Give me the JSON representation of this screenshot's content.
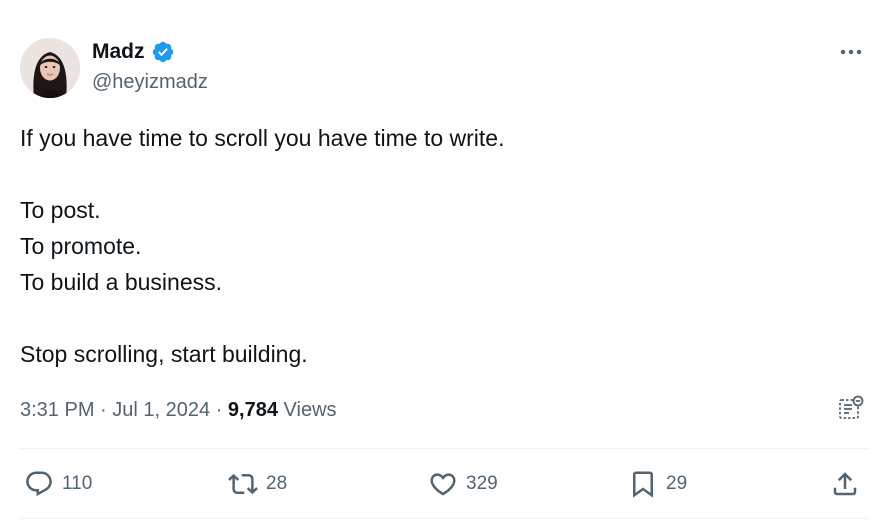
{
  "author": {
    "name": "Madz",
    "handle": "@heyizmadz",
    "verified": true
  },
  "tweet": {
    "lines": [
      "If you have time to scroll you have time to write.",
      "",
      "To post.",
      "To promote.",
      "To build a business.",
      "",
      "Stop scrolling, start building."
    ],
    "time": "3:31 PM",
    "date": "Jul 1, 2024",
    "views_count": "9,784",
    "views_label": "Views"
  },
  "stats": {
    "replies": "110",
    "reposts": "28",
    "likes": "329",
    "bookmarks": "29"
  },
  "colors": {
    "text": "#0f1419",
    "secondary": "#536471",
    "verified": "#1d9bf0",
    "divider": "#eff3f4"
  },
  "icons": [
    "verified-badge-icon",
    "more-icon",
    "community-notes-icon",
    "reply-icon",
    "repost-icon",
    "like-icon",
    "bookmark-icon",
    "share-icon"
  ]
}
